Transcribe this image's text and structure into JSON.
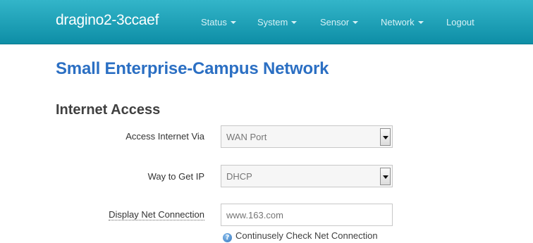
{
  "navbar": {
    "brand": "dragino2-3ccaef",
    "items": [
      {
        "label": "Status",
        "dropdown": true
      },
      {
        "label": "System",
        "dropdown": true
      },
      {
        "label": "Sensor",
        "dropdown": true
      },
      {
        "label": "Network",
        "dropdown": true
      },
      {
        "label": "Logout",
        "dropdown": false
      }
    ],
    "colors": {
      "bar": "#1aa0b8",
      "text": "#d6f1f6"
    }
  },
  "page": {
    "title": "Small Enterprise-Campus Network",
    "section": "Internet Access"
  },
  "form": {
    "access_via": {
      "label": "Access Internet Via",
      "value": "WAN Port"
    },
    "get_ip": {
      "label": "Way to Get IP",
      "value": "DHCP"
    },
    "net_connection": {
      "label": "Display Net Connection",
      "placeholder": "www.163.com",
      "help_icon": "help-icon",
      "help_text": "Continusely Check Net Connection"
    }
  },
  "accent_color": "#2b6fc3"
}
